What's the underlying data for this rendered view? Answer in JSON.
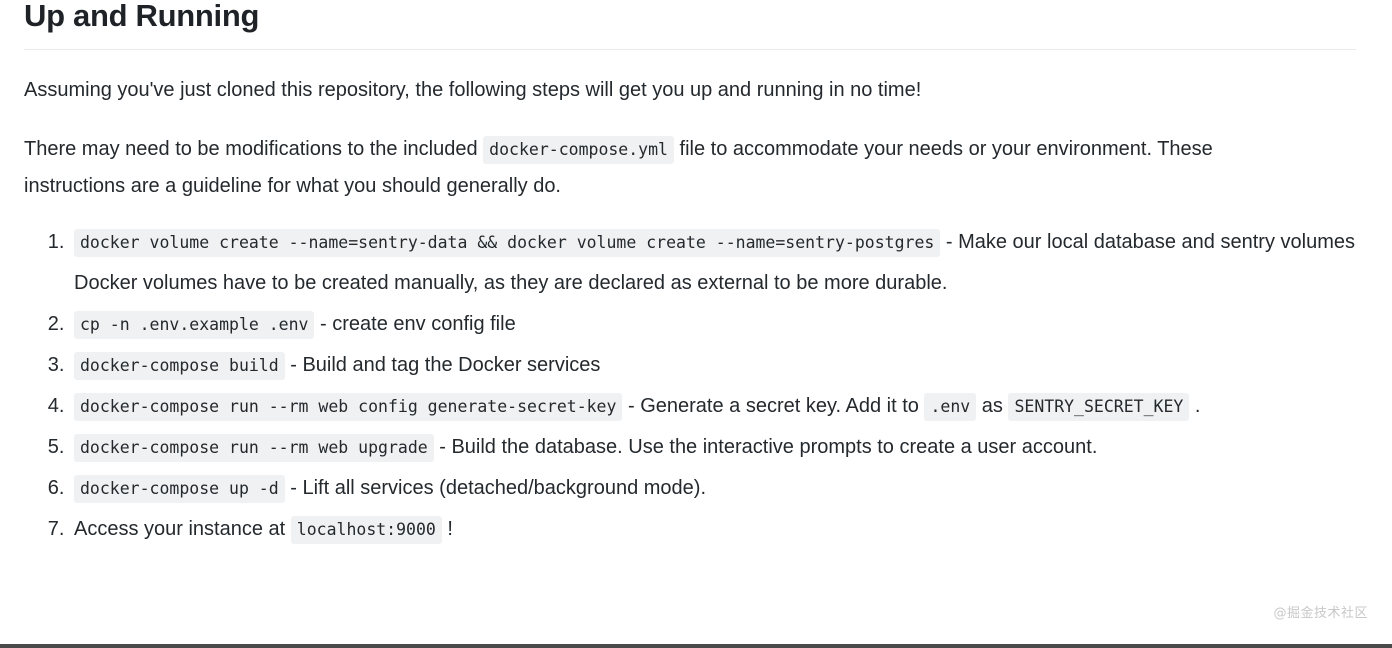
{
  "document": {
    "title": "Up and Running",
    "paragraphs": {
      "intro": "Assuming you've just cloned this repository, the following steps will get you up and running in no time!",
      "mods_before": "There may need to be modifications to the included ",
      "mods_code": "docker-compose.yml",
      "mods_after": " file to accommodate your needs or your environment. These instructions are a guideline for what you should generally do."
    },
    "steps": [
      {
        "number": "1",
        "code": "docker volume create --name=sentry-data && docker volume create --name=sentry-postgres",
        "text": " - Make our local database and sentry volumes Docker volumes have to be created manually, as they are declared as external to be more durable."
      },
      {
        "number": "2",
        "code": "cp -n .env.example .env",
        "text": " - create env config file"
      },
      {
        "number": "3",
        "code": "docker-compose build",
        "text": " - Build and tag the Docker services"
      },
      {
        "number": "4",
        "code": "docker-compose run --rm web config generate-secret-key",
        "text_mid": " - Generate a secret key. Add it to ",
        "code2": ".env",
        "text_mid2": " as ",
        "code3": "SENTRY_SECRET_KEY",
        "text_end": " ."
      },
      {
        "number": "5",
        "code": "docker-compose run --rm web upgrade",
        "text": " - Build the database. Use the interactive prompts to create a user account."
      },
      {
        "number": "6",
        "code": "docker-compose up -d",
        "text": " - Lift all services (detached/background mode)."
      },
      {
        "number": "7",
        "text_start": "Access your instance at ",
        "code": "localhost:9000",
        "text_end": " !"
      }
    ]
  },
  "watermark": {
    "text": "@掘金技术社区"
  },
  "colors": {
    "text": "#24292e",
    "code_bg": "#f0f1f2",
    "rule": "#eaecef",
    "bottom_bar": "#4a4a4a",
    "watermark": "#c8c8c8"
  }
}
